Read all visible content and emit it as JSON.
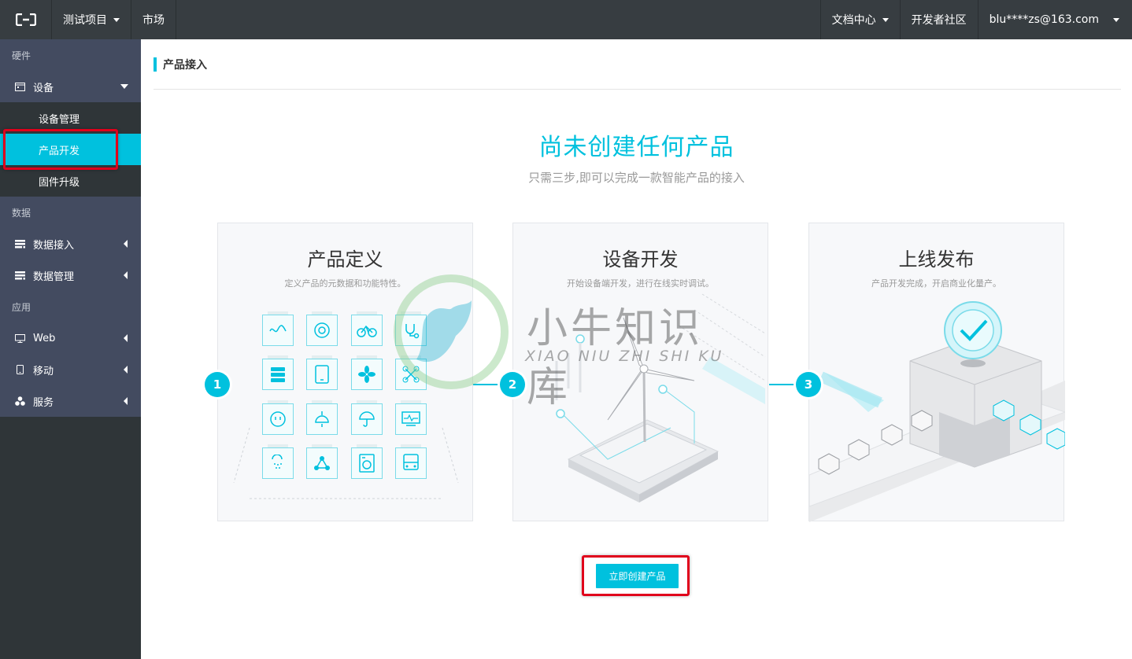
{
  "topbar": {
    "logo_icon": "aliyun-logo-icon",
    "project": "测试项目",
    "market": "市场",
    "docs": "文档中心",
    "community": "开发者社区",
    "user": "blu****zs@163.com"
  },
  "sidebar": {
    "sections": [
      {
        "label": "硬件"
      },
      {
        "label": "数据"
      },
      {
        "label": "应用"
      }
    ],
    "device_group": {
      "label": "设备",
      "icon": "device-icon"
    },
    "device_items": [
      {
        "label": "设备管理"
      },
      {
        "label": "产品开发"
      },
      {
        "label": "固件升级"
      }
    ],
    "data_items": [
      {
        "label": "数据接入",
        "icon": "database-icon"
      },
      {
        "label": "数据管理",
        "icon": "database-icon"
      }
    ],
    "app_items": [
      {
        "label": "Web",
        "icon": "monitor-icon"
      },
      {
        "label": "移动",
        "icon": "mobile-icon"
      },
      {
        "label": "服务",
        "icon": "cluster-icon"
      }
    ]
  },
  "main": {
    "page_title": "产品接入",
    "hero_title": "尚未创建任何产品",
    "hero_subtitle": "只需三步,即可以完成一款智能产品的接入",
    "steps": [
      {
        "num": "1",
        "title": "产品定义",
        "desc": "定义产品的元数据和功能特性。"
      },
      {
        "num": "2",
        "title": "设备开发",
        "desc": "开始设备端开发，进行在线实时调试。"
      },
      {
        "num": "3",
        "title": "上线发布",
        "desc": "产品开发完成，开启商业化量产。"
      }
    ],
    "cta_label": "立即创建产品"
  },
  "watermark": {
    "title": "小牛知识库",
    "subtitle": "XIAO NIU ZHI SHI KU"
  },
  "colors": {
    "accent": "#00c1de",
    "topbar": "#373d41",
    "sidebar_dark": "#2f3538",
    "sidebar_group": "#434b60",
    "highlight": "#e0001b"
  }
}
